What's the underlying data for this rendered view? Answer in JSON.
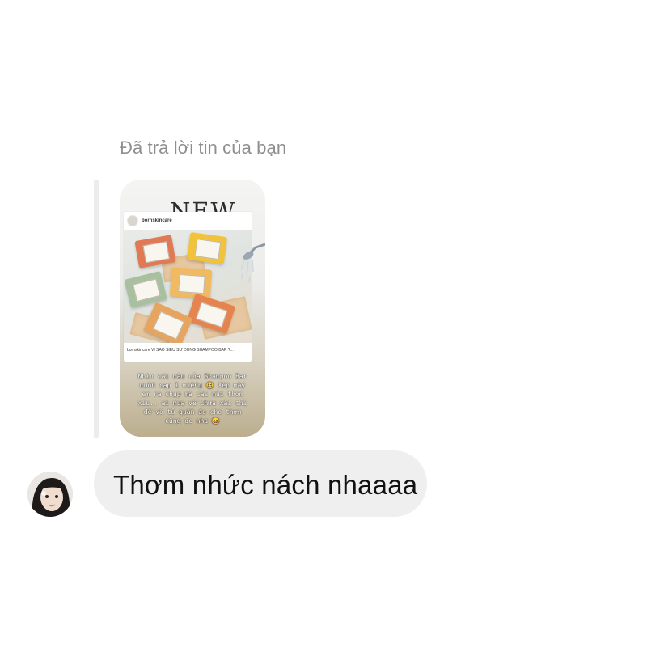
{
  "reply": {
    "label": "Đã trả lời tin của bạn"
  },
  "story": {
    "badge": "NEW",
    "post": {
      "username": "bornskincare",
      "caption": "bornskincare VÌ SAO SIÊU SỬ DỤNG SHAMPOO BAR ?..."
    },
    "text": "Nhìn cái màu của Shampoo Bar\nmuốn cạp 1 miếng 😆 Xếp mấy\nem ra chụp mà cái mùi thơm\nxíu.. ai mua về chưa xài thì\nđể vô tủ quần áo cho thơm\ncũng đc nha 😄",
    "soap_colors": [
      "#e07a55",
      "#f2c23a",
      "#a9c0a0",
      "#f1b960",
      "#e6844f",
      "#e7a45f"
    ]
  },
  "message": {
    "text": "Thơm nhức nách nhaaaa"
  }
}
